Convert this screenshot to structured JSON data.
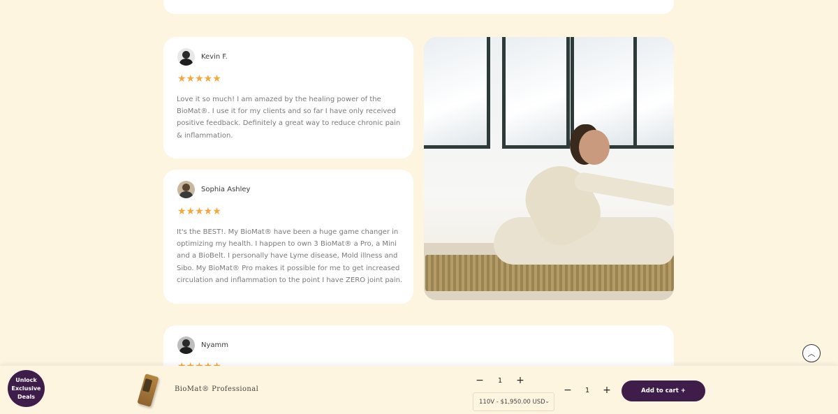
{
  "reviews": [
    {
      "name": "Kevin F.",
      "stars": "★★★★★",
      "text": "Love it so much! I am amazed by the healing power of the BioMat®. I use it for my clients and so far I have only received positive feedback. Definitely a great way to reduce chronic pain & inflammation."
    },
    {
      "name": "Sophia Ashley",
      "stars": "★★★★★",
      "text": "It's the BEST!. My BioMat® have been a huge game changer in optimizing my health. I happen to own 3 BioMat® a Pro, a Mini and a BioBelt.  I personally have Lyme disease, Mold illness and Sibo.  My BioMat® Pro makes it possible for me to get increased circulation and  inflammation to the point I have ZERO joint pain."
    },
    {
      "name": "Nyamm",
      "stars": "★★★★★"
    }
  ],
  "scroll_top": {
    "icon": "chevron-up-icon",
    "glyph": "︿"
  },
  "cart_bar": {
    "product_name": "BioMat® Professional",
    "qty_top": {
      "minus": "−",
      "value": "1",
      "plus": "+"
    },
    "variant": {
      "selected": "110V - $1,950.00 USD",
      "chevron": "⌄"
    },
    "qty": {
      "minus": "−",
      "value": "1",
      "plus": "+"
    },
    "add_to_cart": "Add to cart +",
    "accent_color": "#3f1d4b"
  },
  "deals_badge": {
    "line1": "Unlock",
    "line2": "Exclusive",
    "line3": "Deals"
  }
}
